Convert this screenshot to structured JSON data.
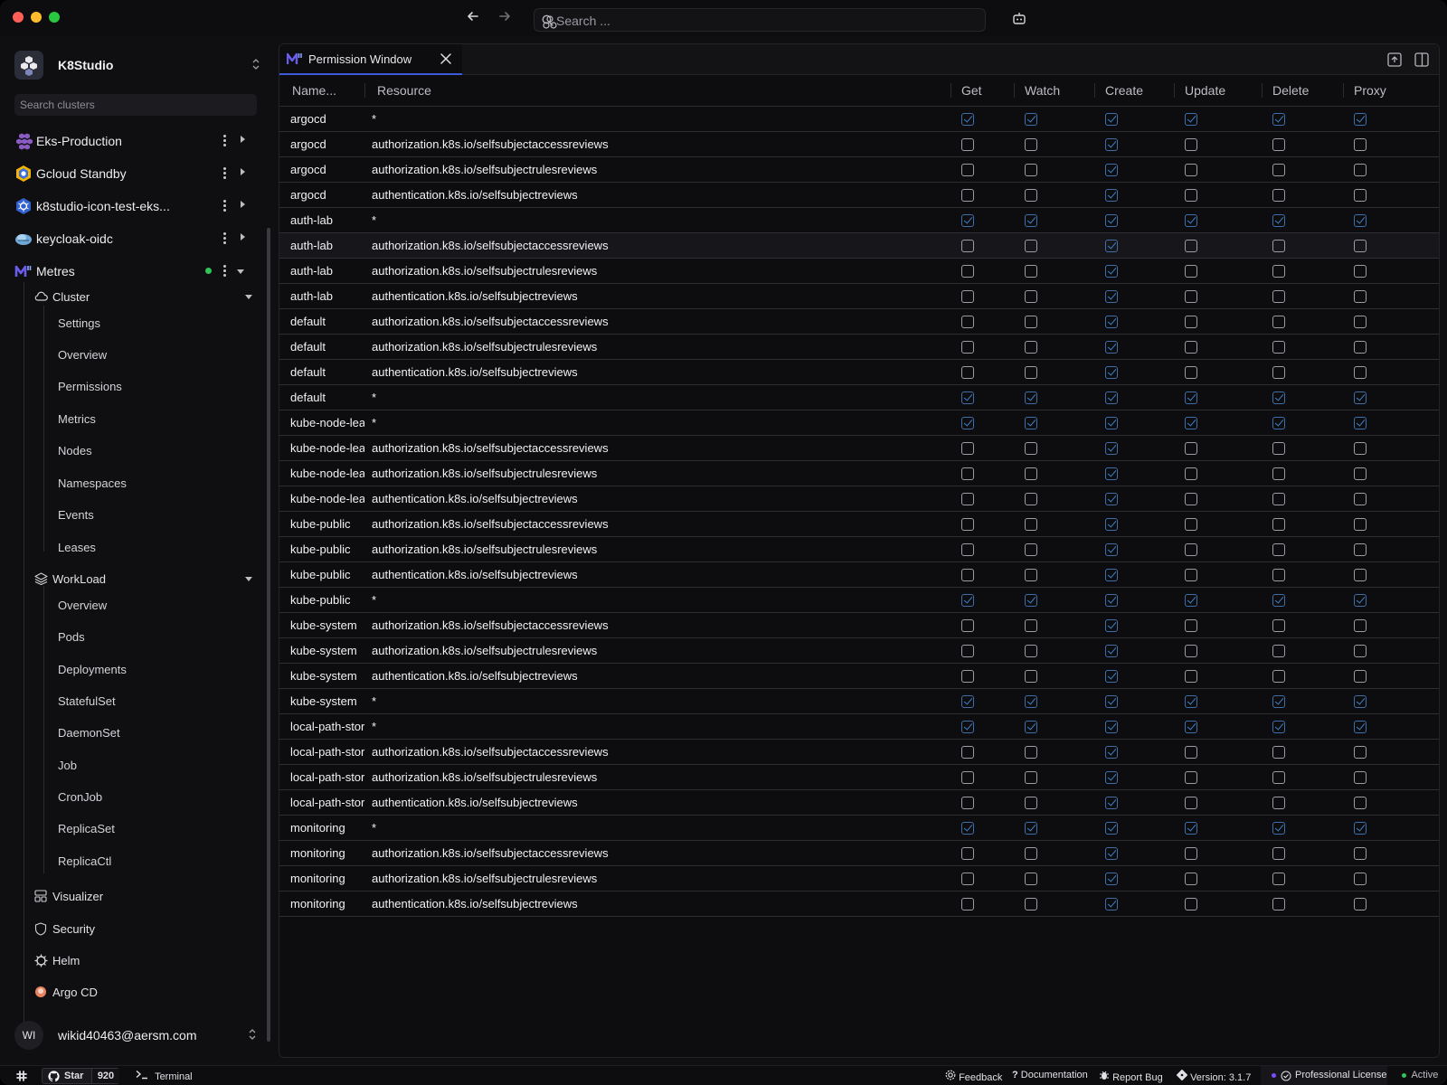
{
  "titlebar": {
    "search_placeholder": "Search ...",
    "icons": [
      "arrow-left-icon",
      "arrow-right-icon",
      "search-icon",
      "ai-icon",
      "bot-icon"
    ]
  },
  "brand": {
    "name": "K8Studio"
  },
  "sidebar": {
    "search_placeholder": "Search clusters",
    "clusters": [
      {
        "label": "Eks-Production",
        "icon": "eks-icon"
      },
      {
        "label": "Gcloud Standby",
        "icon": "gcloud-icon"
      },
      {
        "label": "k8studio-icon-test-eks...",
        "icon": "kubernetes-icon"
      },
      {
        "label": "keycloak-oidc",
        "icon": "keycloak-icon"
      },
      {
        "label": "Metres",
        "icon": "metres-icon",
        "status": "connected"
      }
    ],
    "cluster_group": {
      "label": "Cluster",
      "items": [
        "Settings",
        "Overview",
        "Permissions",
        "Metrics",
        "Nodes",
        "Namespaces",
        "Events",
        "Leases"
      ]
    },
    "workload_group": {
      "label": "WorkLoad",
      "items": [
        "Overview",
        "Pods",
        "Deployments",
        "StatefulSet",
        "DaemonSet",
        "Job",
        "CronJob",
        "ReplicaSet",
        "ReplicaCtl"
      ]
    },
    "bottom_items": [
      {
        "label": "Visualizer",
        "icon": "visualizer-icon"
      },
      {
        "label": "Security",
        "icon": "shield-icon"
      },
      {
        "label": "Helm",
        "icon": "helm-icon"
      },
      {
        "label": "Argo CD",
        "icon": "argo-icon"
      }
    ],
    "user": {
      "initials": "WI",
      "email": "wikid40463@aersm.com"
    }
  },
  "tab": {
    "title": "Permission Window"
  },
  "table": {
    "columns": [
      "Name...",
      "Resource",
      "Get",
      "Watch",
      "Create",
      "Update",
      "Delete",
      "Proxy"
    ],
    "rows": [
      {
        "name": "argocd",
        "resource": "*",
        "perms": [
          1,
          1,
          1,
          1,
          1,
          1
        ]
      },
      {
        "name": "argocd",
        "resource": "authorization.k8s.io/selfsubjectaccessreviews",
        "perms": [
          0,
          0,
          1,
          0,
          0,
          0
        ]
      },
      {
        "name": "argocd",
        "resource": "authorization.k8s.io/selfsubjectrulesreviews",
        "perms": [
          0,
          0,
          1,
          0,
          0,
          0
        ]
      },
      {
        "name": "argocd",
        "resource": "authentication.k8s.io/selfsubjectreviews",
        "perms": [
          0,
          0,
          1,
          0,
          0,
          0
        ]
      },
      {
        "name": "auth-lab",
        "resource": "*",
        "perms": [
          1,
          1,
          1,
          1,
          1,
          1
        ]
      },
      {
        "name": "auth-lab",
        "resource": "authorization.k8s.io/selfsubjectaccessreviews",
        "perms": [
          0,
          0,
          1,
          0,
          0,
          0
        ],
        "highlight": true
      },
      {
        "name": "auth-lab",
        "resource": "authorization.k8s.io/selfsubjectrulesreviews",
        "perms": [
          0,
          0,
          1,
          0,
          0,
          0
        ]
      },
      {
        "name": "auth-lab",
        "resource": "authentication.k8s.io/selfsubjectreviews",
        "perms": [
          0,
          0,
          1,
          0,
          0,
          0
        ]
      },
      {
        "name": "default",
        "resource": "authorization.k8s.io/selfsubjectaccessreviews",
        "perms": [
          0,
          0,
          1,
          0,
          0,
          0
        ]
      },
      {
        "name": "default",
        "resource": "authorization.k8s.io/selfsubjectrulesreviews",
        "perms": [
          0,
          0,
          1,
          0,
          0,
          0
        ]
      },
      {
        "name": "default",
        "resource": "authentication.k8s.io/selfsubjectreviews",
        "perms": [
          0,
          0,
          1,
          0,
          0,
          0
        ]
      },
      {
        "name": "default",
        "resource": "*",
        "perms": [
          1,
          1,
          1,
          1,
          1,
          1
        ]
      },
      {
        "name": "kube-node-lease",
        "resource": "*",
        "perms": [
          1,
          1,
          1,
          1,
          1,
          1
        ]
      },
      {
        "name": "kube-node-lease",
        "resource": "authorization.k8s.io/selfsubjectaccessreviews",
        "perms": [
          0,
          0,
          1,
          0,
          0,
          0
        ]
      },
      {
        "name": "kube-node-lease",
        "resource": "authorization.k8s.io/selfsubjectrulesreviews",
        "perms": [
          0,
          0,
          1,
          0,
          0,
          0
        ]
      },
      {
        "name": "kube-node-lease",
        "resource": "authentication.k8s.io/selfsubjectreviews",
        "perms": [
          0,
          0,
          1,
          0,
          0,
          0
        ]
      },
      {
        "name": "kube-public",
        "resource": "authorization.k8s.io/selfsubjectaccessreviews",
        "perms": [
          0,
          0,
          1,
          0,
          0,
          0
        ]
      },
      {
        "name": "kube-public",
        "resource": "authorization.k8s.io/selfsubjectrulesreviews",
        "perms": [
          0,
          0,
          1,
          0,
          0,
          0
        ]
      },
      {
        "name": "kube-public",
        "resource": "authentication.k8s.io/selfsubjectreviews",
        "perms": [
          0,
          0,
          1,
          0,
          0,
          0
        ]
      },
      {
        "name": "kube-public",
        "resource": "*",
        "perms": [
          1,
          1,
          1,
          1,
          1,
          1
        ]
      },
      {
        "name": "kube-system",
        "resource": "authorization.k8s.io/selfsubjectaccessreviews",
        "perms": [
          0,
          0,
          1,
          0,
          0,
          0
        ]
      },
      {
        "name": "kube-system",
        "resource": "authorization.k8s.io/selfsubjectrulesreviews",
        "perms": [
          0,
          0,
          1,
          0,
          0,
          0
        ]
      },
      {
        "name": "kube-system",
        "resource": "authentication.k8s.io/selfsubjectreviews",
        "perms": [
          0,
          0,
          1,
          0,
          0,
          0
        ]
      },
      {
        "name": "kube-system",
        "resource": "*",
        "perms": [
          1,
          1,
          1,
          1,
          1,
          1
        ]
      },
      {
        "name": "local-path-storage",
        "resource": "*",
        "perms": [
          1,
          1,
          1,
          1,
          1,
          1
        ]
      },
      {
        "name": "local-path-storage",
        "resource": "authorization.k8s.io/selfsubjectaccessreviews",
        "perms": [
          0,
          0,
          1,
          0,
          0,
          0
        ]
      },
      {
        "name": "local-path-storage",
        "resource": "authorization.k8s.io/selfsubjectrulesreviews",
        "perms": [
          0,
          0,
          1,
          0,
          0,
          0
        ]
      },
      {
        "name": "local-path-storage",
        "resource": "authentication.k8s.io/selfsubjectreviews",
        "perms": [
          0,
          0,
          1,
          0,
          0,
          0
        ]
      },
      {
        "name": "monitoring",
        "resource": "*",
        "perms": [
          1,
          1,
          1,
          1,
          1,
          1
        ]
      },
      {
        "name": "monitoring",
        "resource": "authorization.k8s.io/selfsubjectaccessreviews",
        "perms": [
          0,
          0,
          1,
          0,
          0,
          0
        ]
      },
      {
        "name": "monitoring",
        "resource": "authorization.k8s.io/selfsubjectrulesreviews",
        "perms": [
          0,
          0,
          1,
          0,
          0,
          0
        ]
      },
      {
        "name": "monitoring",
        "resource": "authentication.k8s.io/selfsubjectreviews",
        "perms": [
          0,
          0,
          1,
          0,
          0,
          0
        ]
      }
    ]
  },
  "statusbar": {
    "github_label": "Star",
    "github_count": "920",
    "terminal": "Terminal",
    "feedback": "Feedback",
    "documentation": "Documentation",
    "report_bug": "Report Bug",
    "version": "Version: 3.1.7",
    "license": "Professional License",
    "active": "Active"
  },
  "colors": {
    "accent": "#3b5bdb",
    "checkbox_on": "#3f82c7",
    "status_ok": "#30c45a",
    "license_dot": "#7c4dff"
  }
}
